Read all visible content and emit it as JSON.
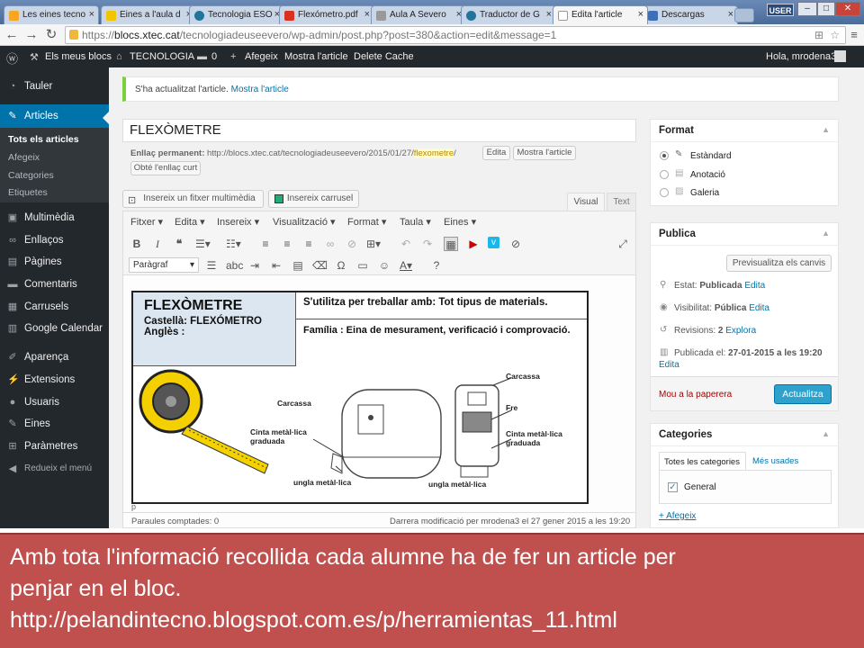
{
  "browser": {
    "tabs": [
      {
        "title": "Les eines tecno",
        "fav_color": "#f6a623"
      },
      {
        "title": "Eines a l'aula d",
        "fav_color": "#f2c500"
      },
      {
        "title": "Tecnologia ESO",
        "fav_color": "#21759b"
      },
      {
        "title": "Flexómetro.pdf",
        "fav_color": "#d9301f"
      },
      {
        "title": "Aula A Severo",
        "fav_color": "#999999"
      },
      {
        "title": "Traductor de G",
        "fav_color": "#21759b"
      },
      {
        "title": "Edita l'article",
        "fav_color": "#ffffff"
      },
      {
        "title": "Descargas",
        "fav_color": "#3f6fb5"
      }
    ],
    "user_badge": "USER",
    "url_domain": "blocs.xtec.cat",
    "url_rest": "/tecnologiadeuseevero/wp-admin/post.php?post=380&action=edit&message=1",
    "url_scheme": "https://"
  },
  "adminbar": {
    "my_sites": "Els meus blocs",
    "site": "TECNOLOGIA",
    "comments_count": "0",
    "new": "Afegeix",
    "view": "Mostra l'article",
    "delete_cache": "Delete Cache",
    "greeting": "Hola, mrodena3"
  },
  "sidebar": {
    "dashboard": "Tauler",
    "articles": "Articles",
    "sub": [
      "Tots els articles",
      "Afegeix",
      "Categories",
      "Etiquetes"
    ],
    "items": [
      "Multimèdia",
      "Enllaços",
      "Pàgines",
      "Comentaris",
      "Carrusels",
      "Google Calendar"
    ],
    "items2": [
      "Aparença",
      "Extensions",
      "Usuaris",
      "Eines",
      "Paràmetres"
    ],
    "collapse": "Redueix el menú"
  },
  "notice": {
    "text": "S'ha actualitzat l'article.",
    "link": "Mostra l'article"
  },
  "post": {
    "title": "FLEXÒMETRE",
    "permalink_label": "Enllaç permanent:",
    "permalink_base": "http://blocs.xtec.cat/tecnologiadeuseevero/2015/01/27/",
    "permalink_slug": "flexometre",
    "permalink_end": "/",
    "edit_btn": "Edita",
    "view_btn": "Mostra l'article",
    "shortlink_btn": "Obté l'enllaç curt",
    "media_btn": "Insereix un fitxer multimèdia",
    "carousel_btn": "Insereix carrusel",
    "tab_visual": "Visual",
    "tab_text": "Text",
    "menus": [
      "Fitxer",
      "Edita",
      "Insereix",
      "Visualització",
      "Format",
      "Taula",
      "Eines"
    ],
    "format_select": "Paràgraf",
    "path": "p",
    "word_count": "Paraules comptades: 0",
    "last_modified": "Darrera modificació per mrodena3 el 27 gener 2015 a les 19:20"
  },
  "doc": {
    "title": "FLEXÒMETRE",
    "castella": "Castellà:  FLEXÓMETRO",
    "angles": "Anglès :",
    "use": "S'utilitza per treballar amb:  Tot tipus de materials.",
    "family": "Família : Eina de mesurament, verificació i comprovació.",
    "labels": {
      "carcassa1": "Carcassa",
      "cinta": "Cinta metàl·lica graduada",
      "ungla1": "ungla  metàl·lica",
      "carcassa2": "Carcassa",
      "fre": "Fre",
      "cinta2": "Cinta metàl·lica graduada",
      "ungla2": "ungla  metàl·lica"
    }
  },
  "format_box": {
    "title": "Format",
    "options": [
      "Estàndard",
      "Anotació",
      "Galeria"
    ]
  },
  "publish_box": {
    "title": "Publica",
    "preview_btn": "Previsualitza els canvis",
    "status_label": "Estat:",
    "status_value": "Publicada",
    "visibility_label": "Visibilitat:",
    "visibility_value": "Pública",
    "revisions_label": "Revisions:",
    "revisions_value": "2",
    "revisions_link": "Explora",
    "published_label": "Publicada el:",
    "published_value": "27-01-2015 a les 19:20",
    "edit": "Edita",
    "trash": "Mou a la paperera",
    "update_btn": "Actualitza"
  },
  "categories_box": {
    "title": "Categories",
    "tab_all": "Totes les categories",
    "tab_used": "Més usades",
    "items": [
      "General"
    ],
    "add": "+ Afegeix"
  },
  "banner": {
    "line1": "Amb tota l'informació recollida cada alumne ha de fer un article per",
    "line2": "penjar en el bloc.",
    "line3": "http://pelandintecno.blogspot.com.es/p/herramientas_11.html"
  }
}
